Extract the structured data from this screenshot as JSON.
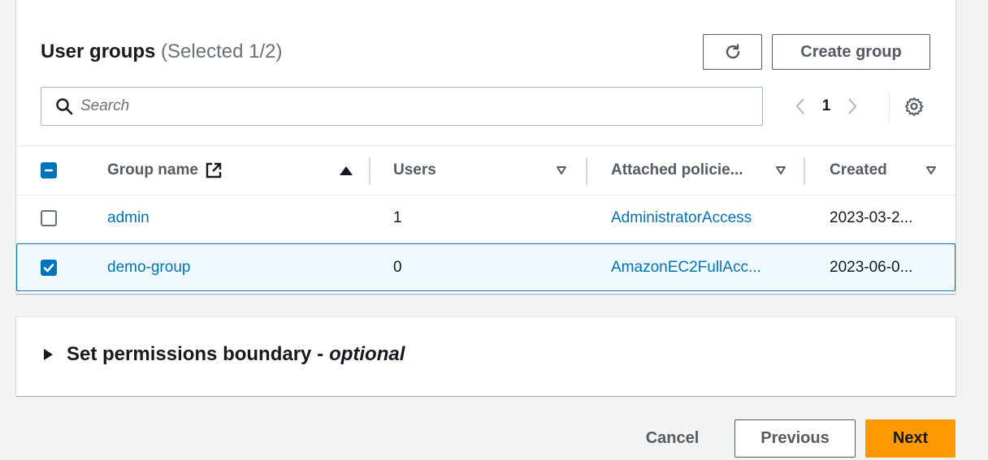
{
  "groups_panel": {
    "title": "User groups",
    "selection_text": "(Selected 1/2)",
    "refresh_icon": "refresh-icon",
    "create_button": "Create group",
    "search": {
      "placeholder": "Search",
      "value": ""
    },
    "pagination": {
      "current_page": "1"
    },
    "settings_icon": "gear-icon",
    "columns": [
      {
        "label": "Group name",
        "icon": "external-link-icon",
        "sort": "ascending"
      },
      {
        "label": "Users",
        "sort": "none"
      },
      {
        "label": "Attached policie...",
        "sort": "none"
      },
      {
        "label": "Created",
        "sort": "none"
      }
    ],
    "header_checkbox_state": "indeterminate",
    "rows": [
      {
        "selected": false,
        "group_name": "admin",
        "users": "1",
        "policies": "AdministratorAccess",
        "created": "2023-03-2..."
      },
      {
        "selected": true,
        "group_name": "demo-group",
        "users": "0",
        "policies": "AmazonEC2FullAcc...",
        "created": "2023-06-0..."
      }
    ]
  },
  "boundary": {
    "title": "Set permissions boundary -",
    "optional": "optional"
  },
  "footer": {
    "cancel": "Cancel",
    "previous": "Previous",
    "next": "Next"
  },
  "colors": {
    "link": "#0073bb",
    "primary": "#ff9900",
    "selected_row_bg": "#f1faff"
  }
}
